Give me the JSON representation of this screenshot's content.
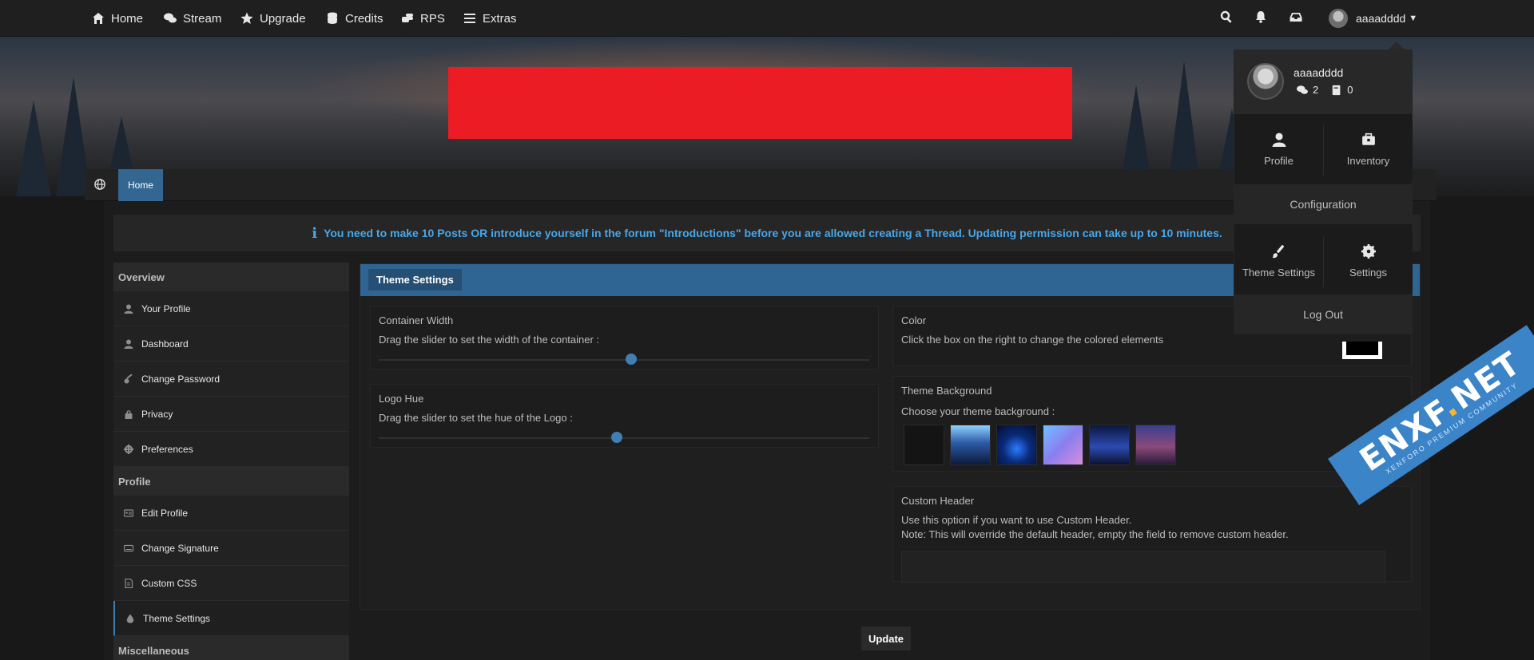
{
  "nav": {
    "items": [
      {
        "label": "Home",
        "icon": "home-icon"
      },
      {
        "label": "Stream",
        "icon": "comments-icon"
      },
      {
        "label": "Upgrade",
        "icon": "star-icon"
      },
      {
        "label": "Credits",
        "icon": "coins-icon"
      },
      {
        "label": "RPS",
        "icon": "hand-icon"
      },
      {
        "label": "Extras",
        "icon": "bars-icon"
      }
    ],
    "username": "aaaadddd"
  },
  "breadcrumb": {
    "home": "Home"
  },
  "notice": {
    "icon_text": "i",
    "text": "You need to make 10 Posts OR introduce yourself in the forum \"Introductions\" before you are allowed creating a Thread. Updating permission can take up to 10 minutes."
  },
  "sidebar": {
    "overview_heading": "Overview",
    "overview_items": [
      "Your Profile",
      "Dashboard",
      "Change Password",
      "Privacy",
      "Preferences"
    ],
    "profile_heading": "Profile",
    "profile_items": [
      "Edit Profile",
      "Change Signature",
      "Custom CSS",
      "Theme Settings"
    ],
    "misc_heading": "Miscellaneous"
  },
  "panel": {
    "tab": "Theme Settings",
    "container_width": {
      "title": "Container Width",
      "desc": "Drag the slider to set the width of the container :",
      "value": 0.52
    },
    "logo_hue": {
      "title": "Logo Hue",
      "desc": "Drag the slider to set the hue of the Logo :",
      "value": 0.49
    },
    "color": {
      "title": "Color",
      "desc": "Click the box on the right to change the colored elements",
      "swatch": "#000000"
    },
    "background": {
      "title": "Theme Background",
      "desc": "Choose your theme background :"
    },
    "custom_header": {
      "title": "Custom Header",
      "desc1": "Use this option if you want to use Custom Header.",
      "desc2": "Note: This will override the default header, empty the field to remove custom header."
    },
    "update": "Update"
  },
  "dropdown": {
    "username": "aaaadddd",
    "messages": "2",
    "reactions": "0",
    "profile": "Profile",
    "inventory": "Inventory",
    "configuration": "Configuration",
    "theme_settings": "Theme Settings",
    "settings": "Settings",
    "logout": "Log Out"
  },
  "colors": {
    "accent": "#336690",
    "notice": "#47a7eb",
    "logo_cover": "#ec1c24"
  }
}
